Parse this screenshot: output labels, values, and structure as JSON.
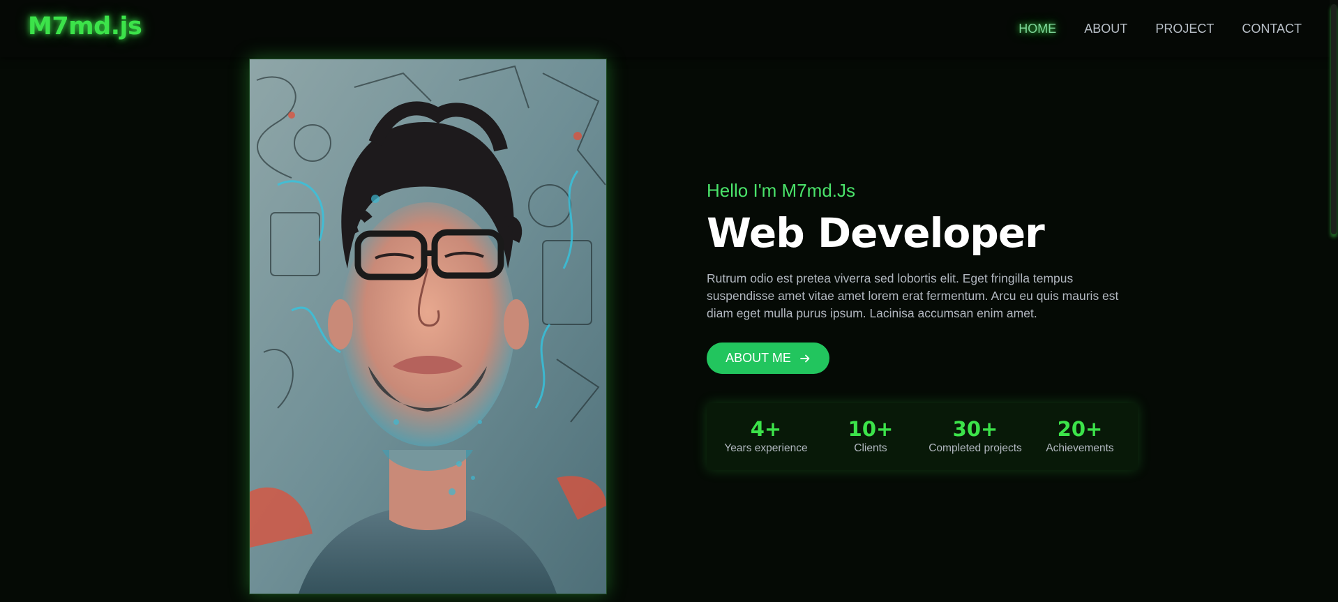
{
  "brand": {
    "logo": "M7md.js"
  },
  "nav": {
    "items": [
      {
        "label": "HOME",
        "active": true
      },
      {
        "label": "ABOUT",
        "active": false
      },
      {
        "label": "PROJECT",
        "active": false
      },
      {
        "label": "CONTACT",
        "active": false
      }
    ]
  },
  "hero": {
    "greeting": "Hello I'm M7md.Js",
    "title": "Web Developer",
    "description": "Rutrum odio est pretea viverra sed lobortis elit. Eget fringilla tempus suspendisse amet vitae amet lorem erat fermentum. Arcu eu quis mauris est diam eget mulla purus ipsum. Lacinisa accumsan enim amet.",
    "button_label": "ABOUT ME",
    "button_icon": "arrow-right-icon"
  },
  "stats": [
    {
      "value": "4+",
      "label": "Years experience"
    },
    {
      "value": "10+",
      "label": "Clients"
    },
    {
      "value": "30+",
      "label": "Completed projects"
    },
    {
      "value": "20+",
      "label": "Achievements"
    }
  ],
  "colors": {
    "accent": "#3ce34a",
    "button": "#22c55e",
    "background": "#050a05"
  }
}
